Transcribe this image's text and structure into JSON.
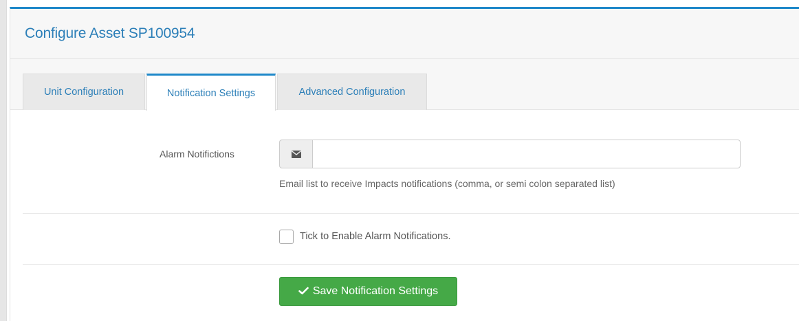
{
  "page": {
    "title": "Configure Asset SP100954"
  },
  "tabs": [
    {
      "label": "Unit Configuration",
      "active": false
    },
    {
      "label": "Notification Settings",
      "active": true
    },
    {
      "label": "Advanced Configuration",
      "active": false
    }
  ],
  "alarm_notifications": {
    "label": "Alarm Notifictions",
    "icon": "envelope-icon",
    "value": "",
    "placeholder": "",
    "help_text": "Email list to receive Impacts notifications (comma, or semi colon separated list)"
  },
  "enable_checkbox": {
    "label": "Tick to Enable Alarm Notifications.",
    "checked": false
  },
  "save_button": {
    "label": "Save Notification Settings",
    "icon": "check-icon",
    "color": "#45a947"
  },
  "colors": {
    "accent": "#1e88c9",
    "title": "#2c7fb8"
  }
}
